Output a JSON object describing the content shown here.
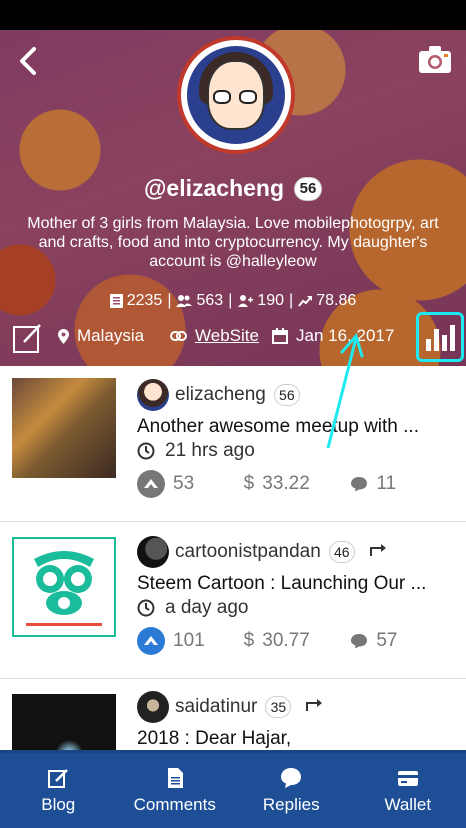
{
  "profile": {
    "username": "@elizacheng",
    "reputation": "56",
    "bio": "Mother of 3 girls from Malaysia. Love mobilephotogrpy, art and crafts, food and into cryptocurrency. My daughter's account is @halleyleow",
    "stats": {
      "posts": "2235",
      "followers": "563",
      "following": "190",
      "power": "78.86"
    },
    "location": "Malaysia",
    "website_label": "WebSite",
    "joined": "Jan 16, 2017"
  },
  "icons": {
    "back": "back-arrow-icon",
    "camera": "camera-icon",
    "edit": "edit-icon",
    "location": "location-pin-icon",
    "link": "link-icon",
    "calendar": "calendar-icon",
    "chart": "bar-chart-icon"
  },
  "colors": {
    "highlight": "#1de9f0",
    "tabbar": "#1e4f96",
    "upvote_active": "#2b7bd6"
  },
  "posts": [
    {
      "author": "elizacheng",
      "author_rep": "56",
      "resteemed": false,
      "title": "Another awesome meetup with ...",
      "time": "21 hrs ago",
      "votes": "53",
      "payout": "33.22",
      "comments": "11",
      "upvoted": false
    },
    {
      "author": "cartoonistpandan",
      "author_rep": "46",
      "resteemed": true,
      "title": "Steem Cartoon : Launching Our ...",
      "time": "a day ago",
      "votes": "101",
      "payout": "30.77",
      "comments": "57",
      "upvoted": true
    },
    {
      "author": "saidatinur",
      "author_rep": "35",
      "resteemed": true,
      "title": "2018 : Dear Hajar,",
      "time": "",
      "votes": "",
      "payout": "",
      "comments": "",
      "upvoted": false
    }
  ],
  "tabs": [
    {
      "label": "Blog",
      "icon": "edit-pencil-icon"
    },
    {
      "label": "Comments",
      "icon": "document-icon"
    },
    {
      "label": "Replies",
      "icon": "chat-bubble-icon"
    },
    {
      "label": "Wallet",
      "icon": "wallet-icon"
    }
  ]
}
